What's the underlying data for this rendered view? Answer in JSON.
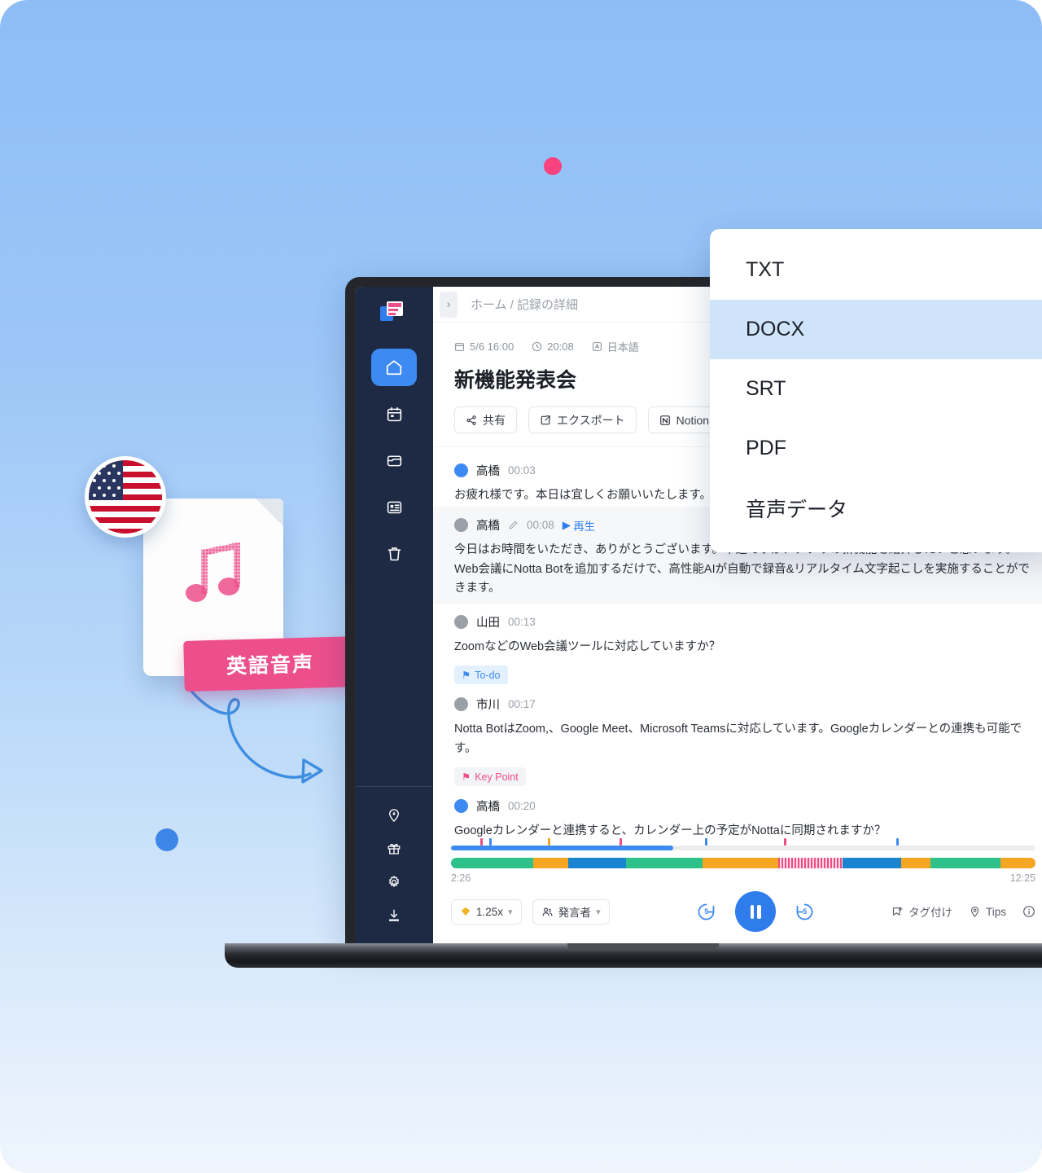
{
  "background": {
    "gradient_top": "#8ebdf6",
    "gradient_bottom": "#eef5fd",
    "dot_pink_color": "#f8437f",
    "dot_blue_color": "#3d86e8",
    "arrow_color": "#3e8ee0"
  },
  "audio_file_card": {
    "banner_label": "英語音声",
    "banner_color": "#ec4f8c",
    "note_icon": "music-note-icon",
    "flag_icon": "us-flag-icon"
  },
  "app": {
    "sidebar": {
      "logo_icon": "notta-logo-icon",
      "items": [
        {
          "icon": "home-icon",
          "name": "home",
          "active": true
        },
        {
          "icon": "calendar-icon",
          "name": "calendar",
          "active": false
        },
        {
          "icon": "folder-icon",
          "name": "folder",
          "active": false
        },
        {
          "icon": "document-icon",
          "name": "document",
          "active": false
        },
        {
          "icon": "trash-icon",
          "name": "trash",
          "active": false
        }
      ],
      "bottom_items": [
        {
          "icon": "pin-icon",
          "name": "pin"
        },
        {
          "icon": "gift-icon",
          "name": "gift"
        },
        {
          "icon": "gear-icon",
          "name": "settings"
        },
        {
          "icon": "download-icon",
          "name": "download"
        }
      ]
    },
    "header": {
      "toggle_icon": "chevron-right-icon",
      "breadcrumb": "ホーム / 記録の詳細",
      "meta": {
        "date_icon": "calendar-icon",
        "date": "5/6 16:00",
        "duration_icon": "clock-icon",
        "duration": "20:08",
        "language_icon": "language-icon",
        "language": "日本語"
      },
      "title": "新機能発表会",
      "actions": [
        {
          "label": "共有",
          "icon": "share-icon"
        },
        {
          "label": "エクスポート",
          "icon": "export-icon"
        },
        {
          "label": "Notion",
          "icon": "notion-icon"
        }
      ]
    },
    "transcript": [
      {
        "speaker": "高橋",
        "time": "00:03",
        "text": "お疲れ様です。本日は宜しくお願いいたします。",
        "avatar_color": "#3d8bf2",
        "highlight": false,
        "editable": false,
        "play_label": "",
        "tag": null
      },
      {
        "speaker": "高橋",
        "time": "00:08",
        "text": "今日はお時間をいただき、ありがとうございます。早速ですが、アプリの新機能を紹介したいと思います。Web会議にNotta Botを追加するだけで、高性能AIが自動で録音&リアルタイム文字起こしを実施することができます。",
        "avatar_color": "#9aa0a8",
        "highlight": true,
        "editable": true,
        "play_label": "再生",
        "tag": null
      },
      {
        "speaker": "山田",
        "time": "00:13",
        "text": "ZoomなどのWeb会議ツールに対応していますか？",
        "avatar_color": "#9aa0a8",
        "highlight": false,
        "editable": false,
        "play_label": "",
        "tag": {
          "label": "To-do",
          "kind": "todo",
          "icon": "bookmark-icon"
        }
      },
      {
        "speaker": "市川",
        "time": "00:17",
        "text": "Notta BotはZoom,、Google Meet、Microsoft Teamsに対応しています。Googleカレンダーとの連携も可能です。",
        "avatar_color": "#9aa0a8",
        "highlight": false,
        "editable": false,
        "play_label": "",
        "tag": {
          "label": "Key Point",
          "kind": "keypoint",
          "icon": "bookmark-icon"
        }
      },
      {
        "speaker": "高橋",
        "time": "00:20",
        "text": "Googleカレンダーと連携すると、カレンダー上の予定がNottaに同期されますか？",
        "avatar_color": "#3d8bf2",
        "highlight": false,
        "editable": false,
        "play_label": "",
        "tag": null
      }
    ],
    "player": {
      "progress_percent": 38,
      "current_time": "2:26",
      "total_time": "12:25",
      "markers": [
        {
          "pos": 13,
          "color": "#ef4d86"
        },
        {
          "pos": 17,
          "color": "#3d8bf2"
        },
        {
          "pos": 43,
          "color": "#f5a623"
        },
        {
          "pos": 75,
          "color": "#ef4d86"
        },
        {
          "pos": 113,
          "color": "#3d8bf2"
        },
        {
          "pos": 148,
          "color": "#ef4d86"
        },
        {
          "pos": 198,
          "color": "#3d8bf2"
        }
      ],
      "segments": [
        {
          "width": 14,
          "color": "#2ec28a"
        },
        {
          "width": 6,
          "color": "#f5a623"
        },
        {
          "width": 10,
          "color": "#1b84d0"
        },
        {
          "width": 4,
          "color": "#2ec28a"
        },
        {
          "width": 9,
          "color": "#2ec28a"
        },
        {
          "width": 13,
          "color": "#f5a623"
        },
        {
          "width": 11,
          "color": "#ef4d86"
        },
        {
          "width": 10,
          "color": "#1b84d0"
        },
        {
          "width": 5,
          "color": "#f5a623"
        },
        {
          "width": 12,
          "color": "#2ec28a"
        },
        {
          "width": 6,
          "color": "#f5a623"
        }
      ],
      "speed_label": "1.25x",
      "speed_icon": "diamond-icon",
      "speaker_label": "発言者",
      "speaker_icon": "people-icon",
      "rewind_label": "5",
      "forward_label": "5",
      "play_state": "pause",
      "right_items": [
        {
          "label": "タグ付け",
          "icon": "tag-add-icon"
        },
        {
          "label": "Tips",
          "icon": "tips-icon"
        },
        {
          "label": "",
          "icon": "info-icon"
        }
      ]
    }
  },
  "export_dropdown": {
    "items": [
      {
        "label": "TXT",
        "selected": false
      },
      {
        "label": "DOCX",
        "selected": true
      },
      {
        "label": "SRT",
        "selected": false
      },
      {
        "label": "PDF",
        "selected": false
      },
      {
        "label": "音声データ",
        "selected": false
      }
    ],
    "highlight_color": "#cfe4fb"
  }
}
